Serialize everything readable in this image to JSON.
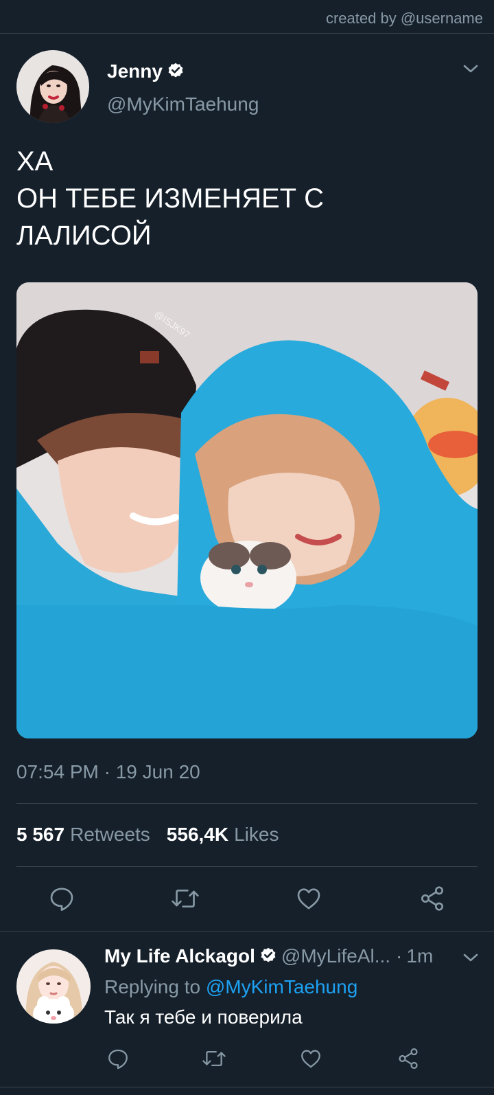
{
  "watermark": "created by @username",
  "tweet": {
    "author_name": "Jenny",
    "author_handle": "@MyKimTaehung",
    "text_lines": [
      "ХА",
      "ОН ТЕБЕ ИЗМЕНЯЕТ С",
      "ЛАЛИСОЙ"
    ],
    "media_watermark": "@ISJK97",
    "timestamp": "07:54 PM · 19 Jun 20",
    "retweets_count": "5 567",
    "retweets_label": "Retweets",
    "likes_count": "556,4K",
    "likes_label": "Likes"
  },
  "reply": {
    "author_name": "My Life Alckagol",
    "author_handle": "@MyLifeAl...",
    "separator": "·",
    "time": "1m",
    "replying_prefix": "Replying to",
    "replying_mention": "@MyKimTaehung",
    "text": "Так я тебе и поверила"
  },
  "colors": {
    "background": "#15202b",
    "secondary_text": "#8899a6",
    "accent": "#1da1f2",
    "divider": "#38444d"
  },
  "icons": {
    "verified": "verified-badge-icon",
    "more": "chevron-down-icon",
    "reply": "reply-icon",
    "retweet": "retweet-icon",
    "like": "heart-icon",
    "share": "share-icon"
  }
}
